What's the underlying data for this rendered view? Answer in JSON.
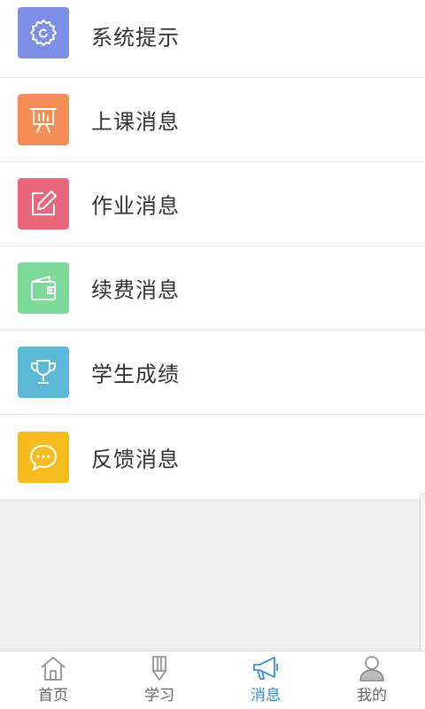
{
  "colors": {
    "system": "#7e8de5",
    "class": "#f58e56",
    "homework": "#e8677a",
    "renewal": "#7cd99a",
    "grades": "#5bb8d6",
    "feedback": "#f6bb1f",
    "tab_active": "#3b8fd6",
    "tab_inactive": "#888888"
  },
  "messages": [
    {
      "label": "系统提示",
      "icon": "gear-icon"
    },
    {
      "label": "上课消息",
      "icon": "presentation-board-icon"
    },
    {
      "label": "作业消息",
      "icon": "edit-pencil-icon"
    },
    {
      "label": "续费消息",
      "icon": "wallet-icon"
    },
    {
      "label": "学生成绩",
      "icon": "trophy-icon"
    },
    {
      "label": "反馈消息",
      "icon": "chat-bubble-icon"
    }
  ],
  "tabbar": {
    "active_tab": "消息",
    "tabs": [
      {
        "label": "首页",
        "icon": "home-icon"
      },
      {
        "label": "学习",
        "icon": "pencil-icon"
      },
      {
        "label": "消息",
        "icon": "megaphone-icon"
      },
      {
        "label": "我的",
        "icon": "user-icon"
      }
    ]
  }
}
